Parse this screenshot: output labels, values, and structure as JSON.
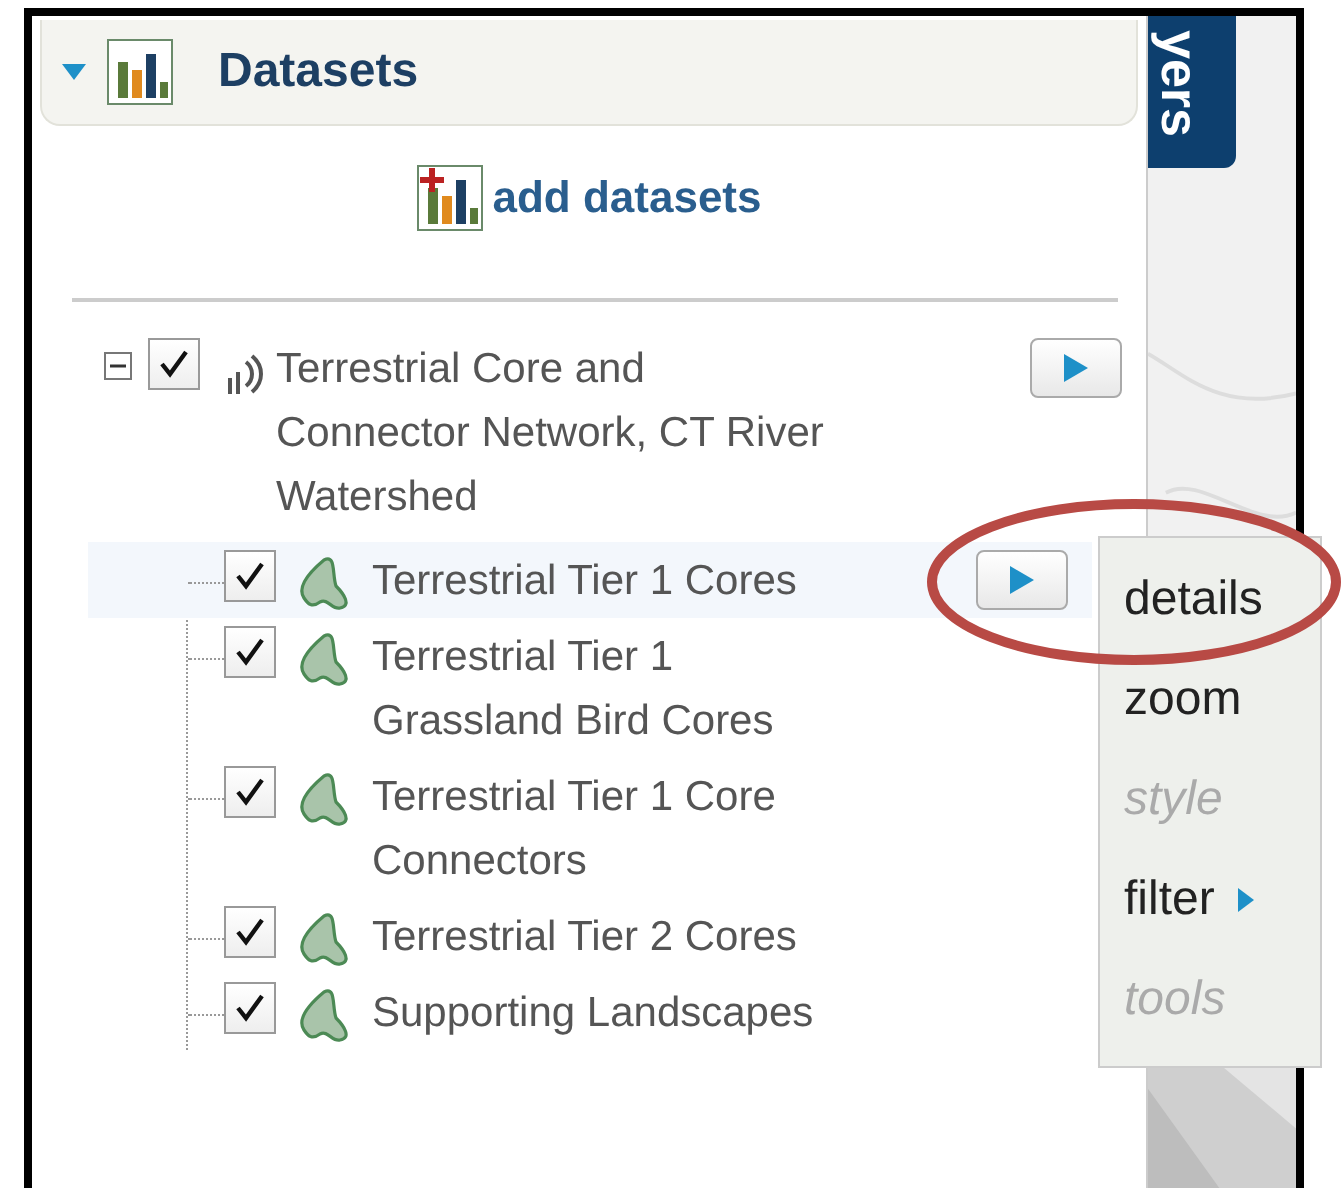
{
  "panel": {
    "title": "Datasets",
    "expanded": true,
    "add_link": "add datasets"
  },
  "tree": [
    {
      "label": "Terrestrial Core and Connector Network, CT River Watershed",
      "expanded": true,
      "checked": true,
      "children": [
        {
          "label": "Terrestrial Tier 1 Cores",
          "checked": true,
          "selected": true
        },
        {
          "label": "Terrestrial Tier 1 Grassland Bird Cores",
          "checked": true,
          "selected": false
        },
        {
          "label": "Terrestrial Tier 1 Core Connectors",
          "checked": true,
          "selected": false
        },
        {
          "label": "Terrestrial Tier 2 Cores",
          "checked": true,
          "selected": false
        },
        {
          "label": "Supporting Landscapes",
          "checked": true,
          "selected": false
        }
      ]
    }
  ],
  "context_menu": {
    "items": [
      {
        "label": "details",
        "disabled": false,
        "submenu": false
      },
      {
        "label": "zoom",
        "disabled": false,
        "submenu": false
      },
      {
        "label": "style",
        "disabled": true,
        "submenu": false
      },
      {
        "label": "filter",
        "disabled": false,
        "submenu": true
      },
      {
        "label": "tools",
        "disabled": true,
        "submenu": false
      }
    ]
  },
  "side_tab": {
    "label": "yers"
  }
}
